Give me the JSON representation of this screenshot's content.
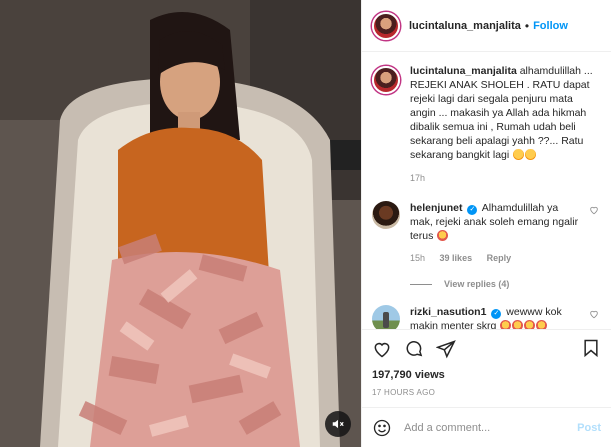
{
  "header": {
    "username": "lucintaluna_manjalita",
    "separator": "•",
    "follow_label": "Follow"
  },
  "caption": {
    "username": "lucintaluna_manjalita",
    "text": "alhamdulillah ... REJEKI ANAK SHOLEH . RATU dapat rejeki lagi dari segala penjuru mata angin ... makasih ya Allah ada hikmah dibalik semua ini , Rumah udah beli sekarang beli apalagi yahh ??... Ratu sekarang bangkit lagi",
    "time": "17h"
  },
  "comments": [
    {
      "username": "helenjunet",
      "text": "Alhamdulillah ya mak, rejeki anak soleh emang ngalir terus",
      "time": "15h",
      "likes": "39 likes",
      "reply_label": "Reply",
      "view_replies": "View replies (4)"
    },
    {
      "username": "rizki_nasution1",
      "text": "wewww kok makin menter skrg"
    }
  ],
  "actions": {
    "views": "197,790 views",
    "time_ago": "17 HOURS AGO"
  },
  "add_comment": {
    "placeholder": "Add a comment...",
    "post_label": "Post"
  },
  "colors": {
    "accent_blue": "#0095f6",
    "post_disabled": "#b2dffc",
    "muted_text": "#8e8e8e"
  }
}
